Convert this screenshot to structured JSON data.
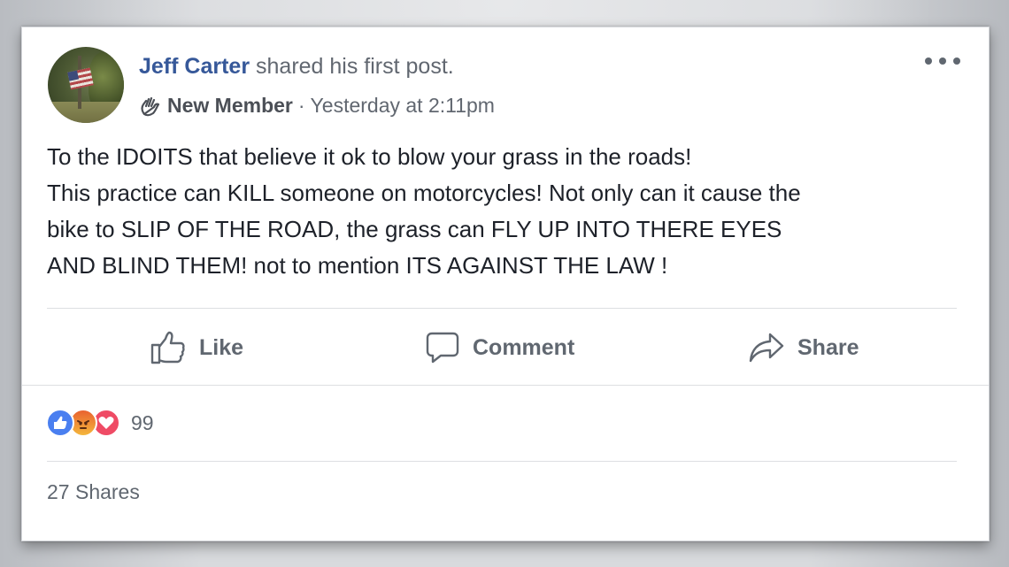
{
  "post": {
    "author": "Jeff Carter",
    "action": "shared his first post.",
    "badge_icon": "wave-icon",
    "badge": "New Member",
    "separator": "·",
    "timestamp": "Yesterday at 2:11pm",
    "body_lines": [
      "To the IDOITS that believe it ok to blow your grass in the roads!",
      "This practice can KILL someone on motorcycles! Not only can it cause the",
      "bike to SLIP OF THE ROAD, the grass can FLY UP INTO THERE EYES",
      "AND BLIND THEM! not to mention ITS AGAINST THE LAW !"
    ]
  },
  "actions": {
    "like_label": "Like",
    "comment_label": "Comment",
    "share_label": "Share"
  },
  "reactions": {
    "icons": [
      "like-icon",
      "angry-icon",
      "love-icon"
    ],
    "count": "99"
  },
  "shares_text": "27 Shares",
  "colors": {
    "author": "#365899",
    "like": "#4a7ff0",
    "love": "#ef4b65",
    "angry": "#e9622f"
  }
}
